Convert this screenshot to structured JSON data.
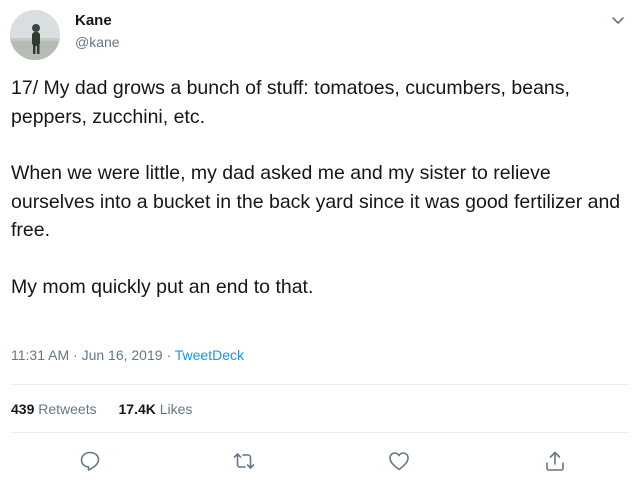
{
  "author": {
    "name": "Kane",
    "handle": "@kane"
  },
  "tweet": {
    "paragraphs": [
      "17/ My dad grows a bunch of stuff: tomatoes, cucumbers, beans, peppers, zucchini, etc.",
      "When we were little, my dad asked me and my sister to relieve ourselves into a bucket in the back yard since it was good fertilizer and free.",
      "My mom quickly put an end to that."
    ]
  },
  "meta": {
    "time": "11:31 AM",
    "date": "Jun 16, 2019",
    "separator": "·",
    "source": "TweetDeck"
  },
  "stats": {
    "retweets_count": "439",
    "retweets_label": "Retweets",
    "likes_count": "17.4K",
    "likes_label": "Likes"
  },
  "icons": {
    "menu": "chevron-down-icon",
    "reply": "reply-icon",
    "retweet": "retweet-icon",
    "like": "heart-icon",
    "share": "share-icon"
  },
  "colors": {
    "text": "#14171a",
    "muted": "#657786",
    "link": "#1b95e0",
    "divider": "#e6ecf0"
  }
}
